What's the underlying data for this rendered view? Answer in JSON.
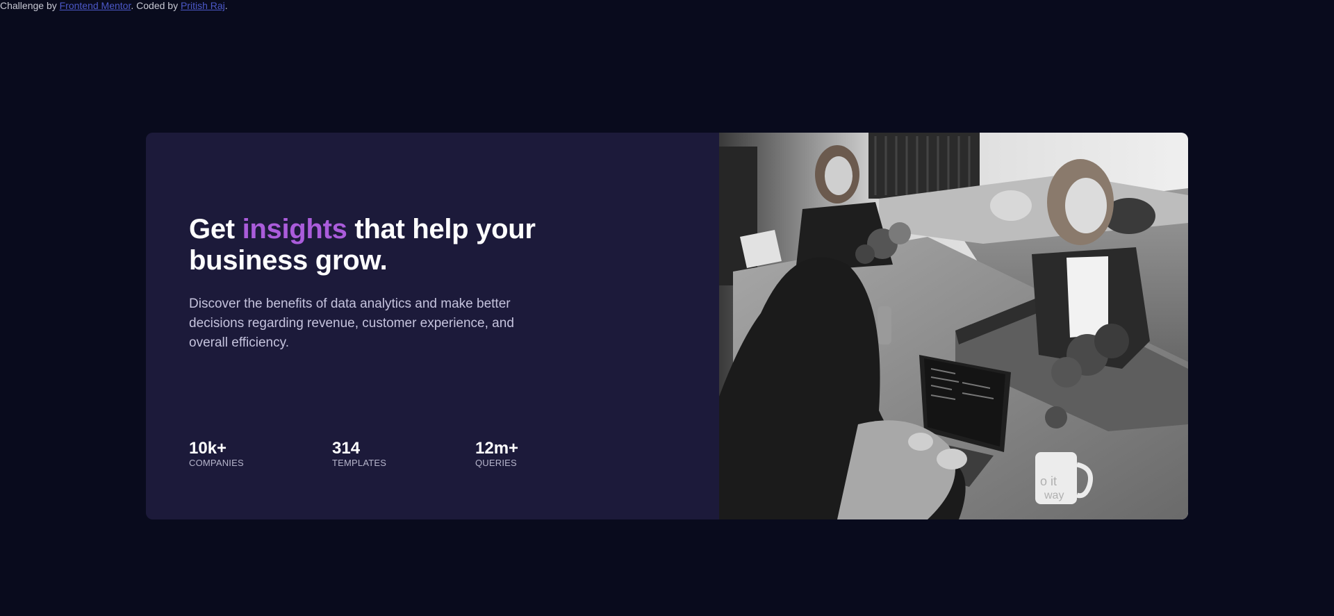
{
  "attribution": {
    "prefix": "Challenge by ",
    "link1": "Frontend Mentor",
    "middle": ". Coded by ",
    "link2": "Pritish Raj",
    "suffix": "."
  },
  "hero": {
    "headline_start": "Get ",
    "headline_accent": "insights",
    "headline_end": " that help your business grow.",
    "description": "Discover the benefits of data analytics and make better decisions regarding revenue, customer experience, and overall efficiency."
  },
  "stats": [
    {
      "value": "10k+",
      "label": "COMPANIES"
    },
    {
      "value": "314",
      "label": "TEMPLATES"
    },
    {
      "value": "12m+",
      "label": "QUERIES"
    }
  ],
  "image": {
    "mug_text_1": "o it",
    "mug_text_2": "way"
  },
  "colors": {
    "background": "#090b1d",
    "card": "#1c1a3a",
    "accent": "#aa5cdb",
    "link": "#4c59c9"
  }
}
